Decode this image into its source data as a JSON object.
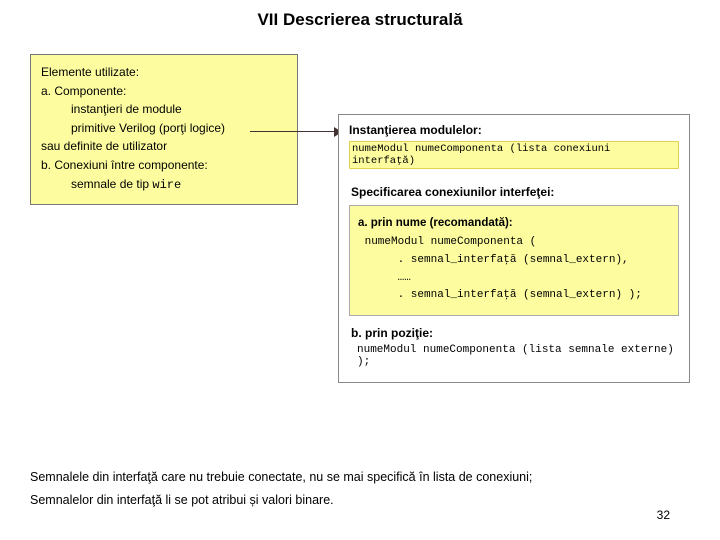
{
  "title": "VII Descrierea structurală",
  "left": {
    "header": "Elemente utilizate:",
    "a": "a. Componente:",
    "a1": "instanţieri de module",
    "a2": "primitive Verilog (porţi logice)",
    "a3": "sau  definite de utilizator",
    "b": "b. Conexiuni între componente:",
    "b1": "semnale de tip ",
    "b1code": "wire"
  },
  "right": {
    "inst_label": "Instanţierea modulelor:",
    "inst_code": "numeModul numeComponenta (lista conexiuni interfaţă)",
    "spec_label": "Specificarea conexiunilor interfeţei:",
    "inner_header": "a. prin nume (recomandată):",
    "inner_l1": " numeModul numeComponenta (",
    "inner_l2": "      . semnal_interfaţă (semnal_extern),",
    "inner_l3": "      ……",
    "inner_l4": "      . semnal_interfaţă (semnal_extern) );",
    "pos_label": "b. prin poziţie:",
    "pos_code": "numeModul numeComponenta (lista semnale externe) );"
  },
  "footer": {
    "l1": "Semnalele din interfaţă care nu trebuie conectate, nu se mai specifică în lista de conexiuni;",
    "l2": "Semnalelor din interfaţă li se pot atribui și valori binare."
  },
  "page": "32"
}
